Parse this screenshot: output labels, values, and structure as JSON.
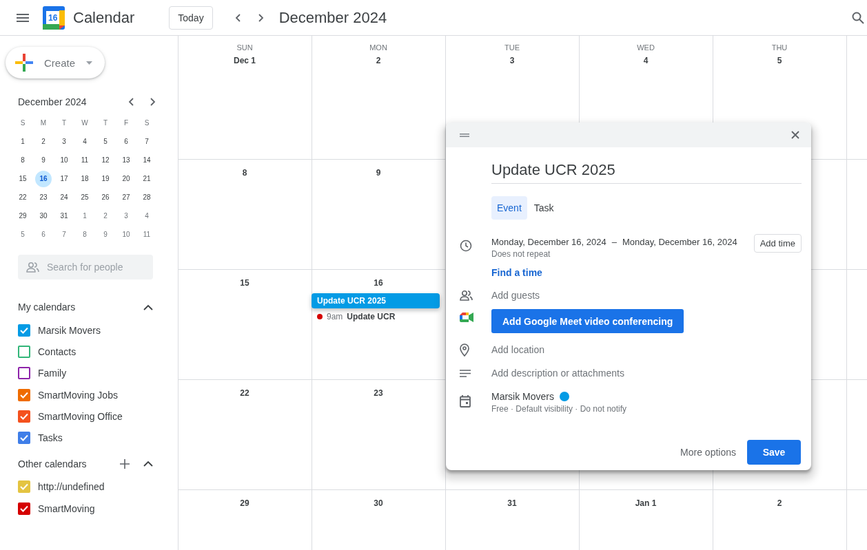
{
  "header": {
    "logo_day": "16",
    "app_name": "Calendar",
    "today_button": "Today",
    "period": "December 2024"
  },
  "create_button": {
    "label": "Create"
  },
  "mini_calendar": {
    "month": "December 2024",
    "weekdays": [
      "S",
      "M",
      "T",
      "W",
      "T",
      "F",
      "S"
    ],
    "weeks": [
      [
        {
          "day": "1",
          "selected": false,
          "outside": false
        },
        {
          "day": "2",
          "selected": false,
          "outside": false
        },
        {
          "day": "3",
          "selected": false,
          "outside": false
        },
        {
          "day": "4",
          "selected": false,
          "outside": false
        },
        {
          "day": "5",
          "selected": false,
          "outside": false
        },
        {
          "day": "6",
          "selected": false,
          "outside": false
        },
        {
          "day": "7",
          "selected": false,
          "outside": false
        }
      ],
      [
        {
          "day": "8",
          "selected": false,
          "outside": false
        },
        {
          "day": "9",
          "selected": false,
          "outside": false
        },
        {
          "day": "10",
          "selected": false,
          "outside": false
        },
        {
          "day": "11",
          "selected": false,
          "outside": false
        },
        {
          "day": "12",
          "selected": false,
          "outside": false
        },
        {
          "day": "13",
          "selected": false,
          "outside": false
        },
        {
          "day": "14",
          "selected": false,
          "outside": false
        }
      ],
      [
        {
          "day": "15",
          "selected": false,
          "outside": false
        },
        {
          "day": "16",
          "selected": true,
          "outside": false
        },
        {
          "day": "17",
          "selected": false,
          "outside": false
        },
        {
          "day": "18",
          "selected": false,
          "outside": false
        },
        {
          "day": "19",
          "selected": false,
          "outside": false
        },
        {
          "day": "20",
          "selected": false,
          "outside": false
        },
        {
          "day": "21",
          "selected": false,
          "outside": false
        }
      ],
      [
        {
          "day": "22",
          "selected": false,
          "outside": false
        },
        {
          "day": "23",
          "selected": false,
          "outside": false
        },
        {
          "day": "24",
          "selected": false,
          "outside": false
        },
        {
          "day": "25",
          "selected": false,
          "outside": false
        },
        {
          "day": "26",
          "selected": false,
          "outside": false
        },
        {
          "day": "27",
          "selected": false,
          "outside": false
        },
        {
          "day": "28",
          "selected": false,
          "outside": false
        }
      ],
      [
        {
          "day": "29",
          "selected": false,
          "outside": false
        },
        {
          "day": "30",
          "selected": false,
          "outside": false
        },
        {
          "day": "31",
          "selected": false,
          "outside": false
        },
        {
          "day": "1",
          "selected": false,
          "outside": true
        },
        {
          "day": "2",
          "selected": false,
          "outside": true
        },
        {
          "day": "3",
          "selected": false,
          "outside": true
        },
        {
          "day": "4",
          "selected": false,
          "outside": true
        }
      ],
      [
        {
          "day": "5",
          "selected": false,
          "outside": true
        },
        {
          "day": "6",
          "selected": false,
          "outside": true
        },
        {
          "day": "7",
          "selected": false,
          "outside": true
        },
        {
          "day": "8",
          "selected": false,
          "outside": true
        },
        {
          "day": "9",
          "selected": false,
          "outside": true
        },
        {
          "day": "10",
          "selected": false,
          "outside": true
        },
        {
          "day": "11",
          "selected": false,
          "outside": true
        }
      ]
    ]
  },
  "people_search": {
    "placeholder": "Search for people"
  },
  "my_calendars": {
    "title": "My calendars",
    "expanded": true,
    "items": [
      {
        "name": "Marsik Movers",
        "color": "#039be5",
        "checked": true
      },
      {
        "name": "Contacts",
        "color": "#33b679",
        "checked": false
      },
      {
        "name": "Family",
        "color": "#8e24aa",
        "checked": false
      },
      {
        "name": "SmartMoving Jobs",
        "color": "#ef6c00",
        "checked": true
      },
      {
        "name": "SmartMoving Office",
        "color": "#f4511e",
        "checked": true
      },
      {
        "name": "Tasks",
        "color": "#3f7ee8",
        "checked": true
      }
    ]
  },
  "other_calendars": {
    "title": "Other calendars",
    "expanded": true,
    "items": [
      {
        "name": "http://undefined",
        "color": "#e4c441",
        "checked": true
      },
      {
        "name": "SmartMoving",
        "color": "#d50000",
        "checked": true
      }
    ]
  },
  "grid": {
    "weekdays": [
      "SUN",
      "MON",
      "TUE",
      "WED",
      "THU"
    ],
    "weeks": [
      {
        "cells": [
          {
            "date": "Dec 1"
          },
          {
            "date": "2"
          },
          {
            "date": "3"
          },
          {
            "date": "4"
          },
          {
            "date": "5"
          }
        ]
      },
      {
        "cells": [
          {
            "date": "8"
          },
          {
            "date": "9"
          },
          {},
          {},
          {}
        ]
      },
      {
        "cells": [
          {
            "date": "15"
          },
          {
            "date": "16",
            "events": [
              {
                "kind": "chip",
                "title": "Update UCR 2025",
                "color": "#039be5"
              },
              {
                "kind": "timed",
                "time": "9am",
                "title": "Update UCR",
                "color": "#d50000"
              }
            ]
          },
          {},
          {},
          {}
        ]
      },
      {
        "cells": [
          {
            "date": "22"
          },
          {
            "date": "23"
          },
          {},
          {},
          {}
        ]
      },
      {
        "cells": [
          {
            "date": "29"
          },
          {
            "date": "30"
          },
          {
            "date": "31"
          },
          {
            "date": "Jan 1"
          },
          {
            "date": "2"
          }
        ]
      }
    ]
  },
  "event_dialog": {
    "title": "Update UCR 2025",
    "tabs": [
      {
        "label": "Event",
        "selected": true
      },
      {
        "label": "Task",
        "selected": false
      }
    ],
    "start": "Monday, December 16, 2024",
    "separator": "–",
    "end": "Monday, December 16, 2024",
    "repeat": "Does not repeat",
    "add_time_button": "Add time",
    "find_time_link": "Find a time",
    "guests_placeholder": "Add guests",
    "meet_button": "Add Google Meet video conferencing",
    "location_placeholder": "Add location",
    "description_placeholder": "Add description or attachments",
    "calendar": {
      "name": "Marsik Movers",
      "color": "#039be5"
    },
    "details": "Free · Default visibility · Do not notify",
    "more_options_button": "More options",
    "save_button": "Save"
  }
}
